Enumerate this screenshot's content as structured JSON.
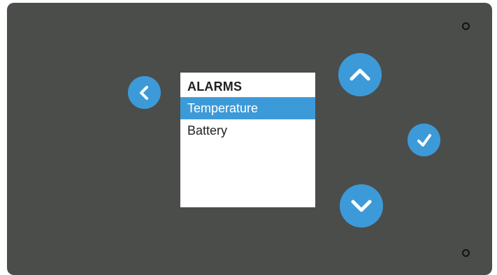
{
  "screen": {
    "title": "ALARMS",
    "items": [
      {
        "label": "Temperature",
        "selected": true
      },
      {
        "label": "Battery",
        "selected": false
      }
    ]
  },
  "buttons": {
    "back": {
      "icon": "chevron-left-icon"
    },
    "up": {
      "icon": "chevron-up-icon"
    },
    "ok": {
      "icon": "check-icon"
    },
    "down": {
      "icon": "chevron-down-icon"
    }
  },
  "colors": {
    "device_body": "#4b4d4b",
    "accent": "#3d9ad9",
    "screen_background": "#ffffff",
    "text": "#222222"
  }
}
